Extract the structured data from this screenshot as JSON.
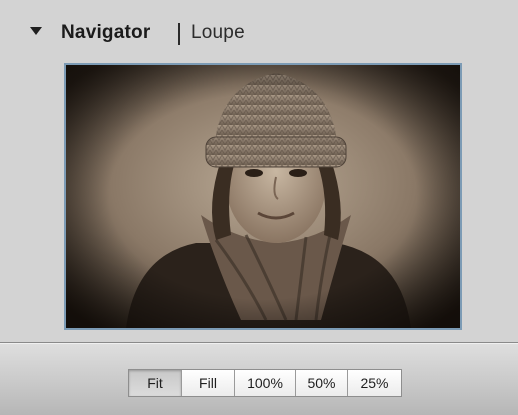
{
  "panel": {
    "tabs": [
      {
        "label": "Navigator",
        "active": true
      },
      {
        "label": "Loupe",
        "active": false
      }
    ],
    "disclosure_icon": "triangle-down-icon"
  },
  "preview": {
    "description": "sepia portrait preview thumbnail",
    "frame_color": "#7c9bb5"
  },
  "zoom": {
    "options": [
      "Fit",
      "Fill",
      "100%",
      "50%",
      "25%"
    ],
    "selected": "Fit"
  }
}
